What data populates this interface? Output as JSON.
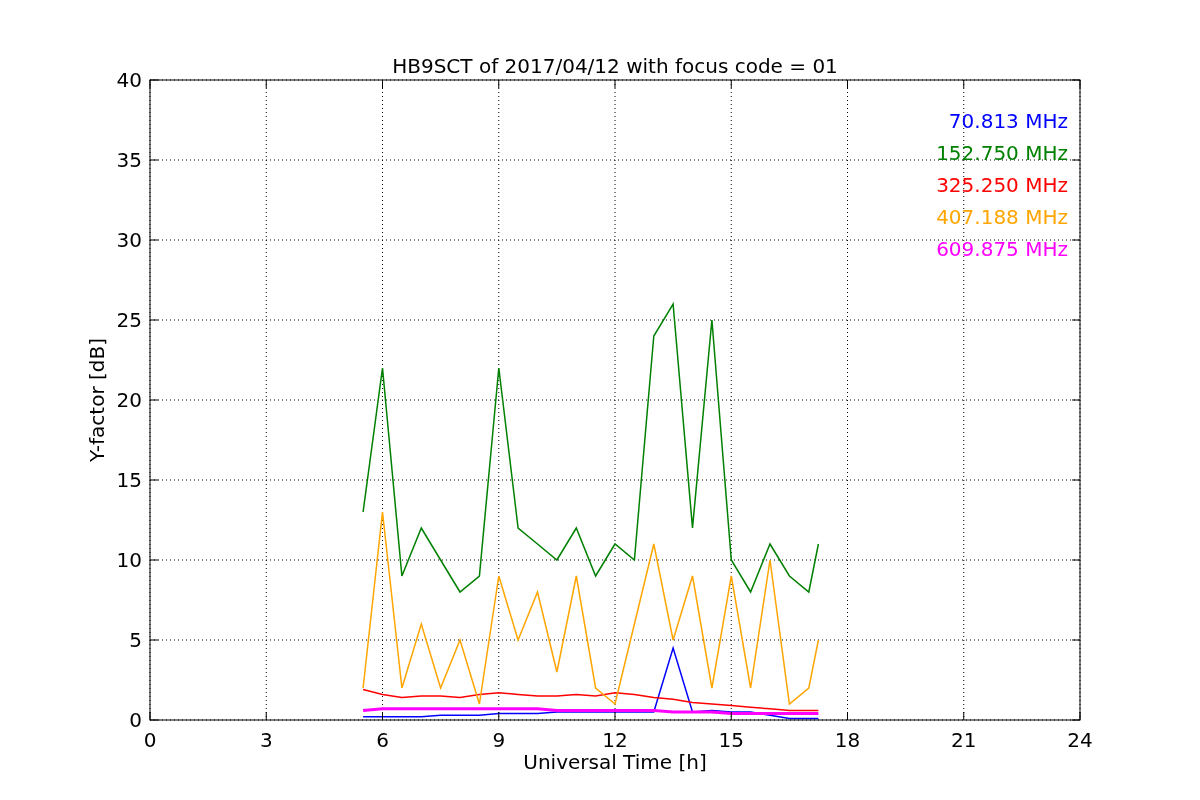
{
  "chart_data": {
    "type": "line",
    "title": "HB9SCT of 2017/04/12 with focus code = 01",
    "xlabel": "Universal Time [h]",
    "ylabel": "Y-factor [dB]",
    "x": [
      5.5,
      6,
      6.5,
      7,
      7.5,
      8,
      8.5,
      9,
      9.5,
      10,
      10.5,
      11,
      11.5,
      12,
      12.5,
      13,
      13.5,
      14,
      14.5,
      15,
      15.5,
      16,
      16.5,
      17,
      17.25
    ],
    "series": [
      {
        "name": "70.813 MHz",
        "color": "#0000ff",
        "values": [
          0.2,
          0.2,
          0.2,
          0.2,
          0.3,
          0.3,
          0.3,
          0.4,
          0.4,
          0.4,
          0.5,
          0.5,
          0.5,
          0.5,
          0.5,
          0.5,
          4.5,
          0.5,
          0.6,
          0.5,
          0.5,
          0.3,
          0.1,
          0.1,
          0.1
        ]
      },
      {
        "name": "152.750 MHz",
        "color": "#008000",
        "values": [
          13,
          22,
          9,
          12,
          10,
          8,
          9,
          22,
          12,
          11,
          10,
          12,
          9,
          11,
          10,
          24,
          26,
          12,
          25,
          10,
          8,
          11,
          9,
          8,
          11
        ]
      },
      {
        "name": "325.250 MHz",
        "color": "#ff0000",
        "values": [
          1.9,
          1.6,
          1.4,
          1.5,
          1.5,
          1.4,
          1.6,
          1.7,
          1.6,
          1.5,
          1.5,
          1.6,
          1.5,
          1.7,
          1.6,
          1.4,
          1.3,
          1.1,
          1.0,
          0.9,
          0.8,
          0.7,
          0.6,
          0.6,
          0.6
        ]
      },
      {
        "name": "407.188 MHz",
        "color": "#ffa500",
        "values": [
          2,
          13,
          2,
          6,
          2,
          5,
          1,
          9,
          5,
          8,
          3,
          9,
          2,
          1,
          6,
          11,
          5,
          9,
          2,
          9,
          2,
          10,
          1,
          2,
          5
        ]
      },
      {
        "name": "609.875 MHz",
        "color": "#ff00ff",
        "values": [
          0.6,
          0.7,
          0.7,
          0.7,
          0.7,
          0.7,
          0.7,
          0.7,
          0.7,
          0.7,
          0.6,
          0.6,
          0.6,
          0.6,
          0.6,
          0.6,
          0.5,
          0.5,
          0.5,
          0.4,
          0.4,
          0.4,
          0.4,
          0.4,
          0.4
        ]
      }
    ],
    "grid": true,
    "xlim": [
      0,
      24
    ],
    "ylim": [
      0,
      40
    ],
    "xticks": [
      0,
      3,
      6,
      9,
      12,
      15,
      18,
      21,
      24
    ],
    "yticks": [
      0,
      5,
      10,
      15,
      20,
      25,
      30,
      35,
      40
    ]
  }
}
